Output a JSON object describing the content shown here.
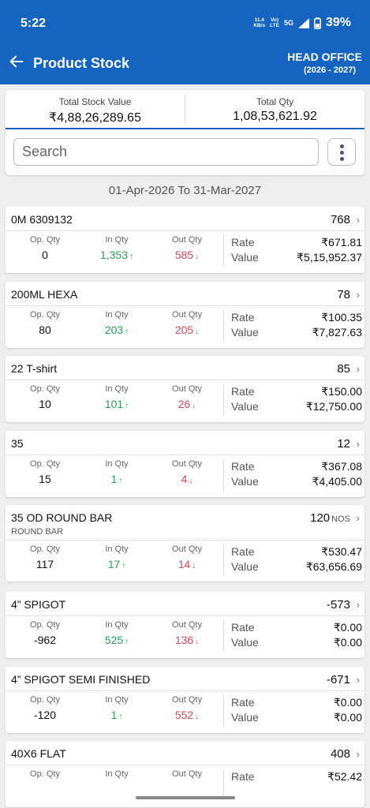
{
  "status": {
    "time": "5:22",
    "speed_top": "11.4",
    "speed_bottom": "KB/s",
    "volte_top": "Vo)",
    "volte_bottom": "LTE",
    "network": "5G",
    "battery": "39%"
  },
  "header": {
    "back_icon": "arrow-left-icon",
    "title": "Product Stock",
    "office": "HEAD OFFICE",
    "year": "(2026 - 2027)"
  },
  "summary": {
    "stock_value_label": "Total Stock Value",
    "stock_value": "₹4,88,26,289.65",
    "qty_label": "Total Qty",
    "qty": "1,08,53,621.92"
  },
  "search": {
    "placeholder": "Search",
    "menu_icon": "more-vertical-icon"
  },
  "date_range": "01-Apr-2026 To 31-Mar-2027",
  "labels": {
    "op": "Op. Qty",
    "in": "In Qty",
    "out": "Out Qty",
    "rate": "Rate",
    "value": "Value"
  },
  "colors": {
    "primary": "#1565c0",
    "in_qty": "#2e9d5b",
    "out_qty": "#d9455f"
  },
  "items": [
    {
      "name": "0M 6309132",
      "sub": "",
      "count": "768",
      "unit": "",
      "op": "0",
      "in": "1,353",
      "out": "585",
      "rate": "₹671.81",
      "value": "₹5,15,952.37"
    },
    {
      "name": "200ML HEXA",
      "sub": "",
      "count": "78",
      "unit": "",
      "op": "80",
      "in": "203",
      "out": "205",
      "rate": "₹100.35",
      "value": "₹7,827.63"
    },
    {
      "name": "22 T-shirt",
      "sub": "",
      "count": "85",
      "unit": "",
      "op": "10",
      "in": "101",
      "out": "26",
      "rate": "₹150.00",
      "value": "₹12,750.00"
    },
    {
      "name": "35",
      "sub": "",
      "count": "12",
      "unit": "",
      "op": "15",
      "in": "1",
      "out": "4",
      "rate": "₹367.08",
      "value": "₹4,405.00"
    },
    {
      "name": "35 OD ROUND BAR",
      "sub": "ROUND BAR",
      "count": "120",
      "unit": "NOS",
      "op": "117",
      "in": "17",
      "out": "14",
      "rate": "₹530.47",
      "value": "₹63,656.69"
    },
    {
      "name": "4” SPIGOT",
      "sub": "",
      "count": "-573",
      "unit": "",
      "op": "-962",
      "in": "525",
      "out": "136",
      "rate": "₹0.00",
      "value": "₹0.00"
    },
    {
      "name": "4” SPIGOT SEMI FINISHED",
      "sub": "",
      "count": "-671",
      "unit": "",
      "op": "-120",
      "in": "1",
      "out": "552",
      "rate": "₹0.00",
      "value": "₹0.00"
    },
    {
      "name": "40X6 FLAT",
      "sub": "",
      "count": "408",
      "unit": "",
      "op": "",
      "in": "",
      "out": "",
      "rate": "₹52.42",
      "value": ""
    }
  ]
}
